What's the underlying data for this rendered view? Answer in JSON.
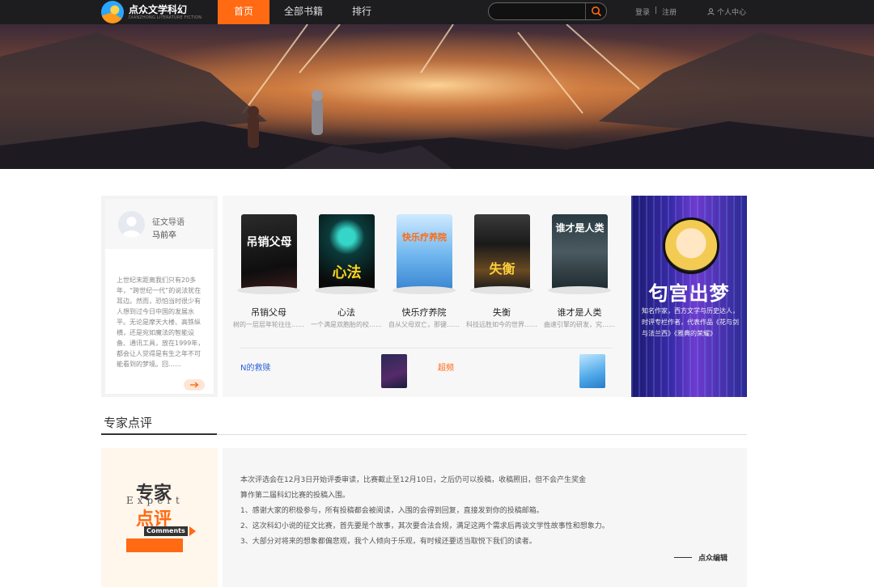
{
  "header": {
    "logo_cn": "点众文学科幻",
    "logo_en": "DIANZHONG LITERATURE FICTION",
    "nav": [
      {
        "label": "首页",
        "active": true
      },
      {
        "label": "全部书籍",
        "active": false
      },
      {
        "label": "排行",
        "active": false
      }
    ],
    "search": {
      "placeholder": "",
      "icon": "search-icon"
    },
    "login": "登录",
    "separator": "|",
    "register": "注册",
    "user_center": "个人中心",
    "accent_color": "#ff6a13"
  },
  "guide": {
    "title": "征文导语",
    "name": "马前卒",
    "text": "上世纪末距离我们只有20多年，“跨世纪一代”的说法犹在耳边。然而，恐怕当时很少有人想到过今日中国的发展水平。无论是摩天大楼、高铁纵横，还是宛如魔法的智能设备、通讯工具，放在1999年，都会让人觉得是有生之年不可能看到的梦境。回……"
  },
  "books": [
    {
      "title": "吊销父母",
      "desc": "树的一层层年轮往往……",
      "cover_text": "吊销父母"
    },
    {
      "title": "心法",
      "desc": "一个满是双胞胎的校……",
      "cover_text": "心法"
    },
    {
      "title": "快乐疗养院",
      "desc": "自从父母双亡，那键……",
      "cover_text": "快乐疗养院"
    },
    {
      "title": "失衡",
      "desc": "科技远胜如今的世界……",
      "cover_text": "失衡"
    },
    {
      "title": "谁才是人类",
      "desc": "曲速引擎的研发，究……",
      "cover_text": "谁才是人类"
    }
  ],
  "mini_books": [
    {
      "label": "N的救赎"
    },
    {
      "label": "超频"
    }
  ],
  "promo": {
    "title": "匂宫出梦",
    "desc": "知名作家，西方文学与历史达人，时评专栏作者，代表作品《花与剑与法兰西》《雅典的荣耀》"
  },
  "review": {
    "section_title": "专家点评",
    "badge_cn1": "专家",
    "badge_en": "Expert",
    "badge_cn2": "点评",
    "badge_tag": "Comments",
    "lines": [
      "本次评选会在12月3日开始评委审读，比赛截止至12月10日，之后仍可以投稿，收稿照旧，但不会产生奖金",
      "算作第二届科幻比赛的投稿入围。",
      "1、感谢大家的积极参与，所有投稿都会被阅读，入围的会得到回复，直接发到你的投稿邮箱。",
      "2、这次科幻小说的征文比赛，首先要是个故事，其次要合法合规，满足这两个需求后再谈文学性故事性和想象力。",
      "3、大部分对将来的想象都偏悲观，我个人倾向于乐观，有时候还要适当取悦下我们的读者。"
    ],
    "signature": "点众编辑"
  }
}
